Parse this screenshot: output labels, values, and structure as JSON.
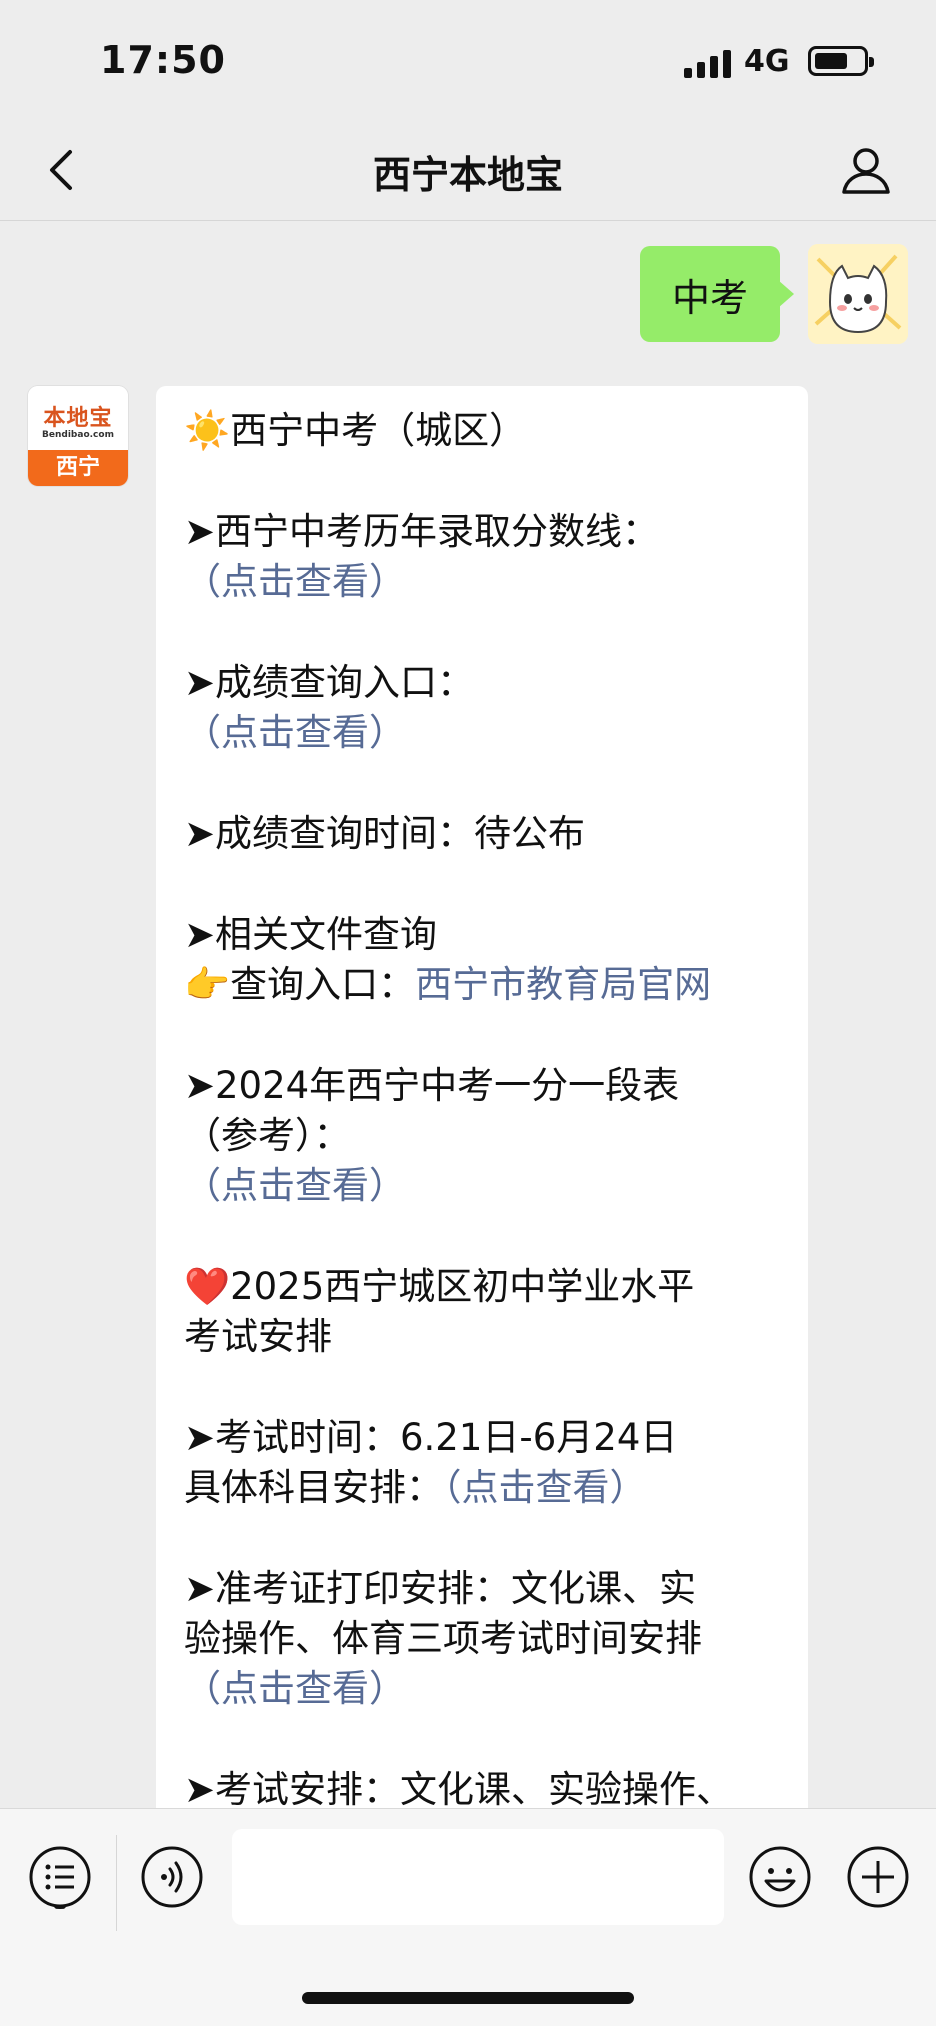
{
  "status_bar": {
    "time": "17:50",
    "network": "4G"
  },
  "nav": {
    "title": "西宁本地宝"
  },
  "user_message": {
    "text": "中考"
  },
  "bot": {
    "avatar": {
      "logo": "本地宝",
      "url": "Bendibao.com",
      "city": "西宁"
    },
    "lines": {
      "p1": "☀️西宁中考（城区）",
      "p2a": "➤西宁中考历年录取分数线：",
      "p2b": "（点击查看）",
      "p3a": "➤成绩查询入口：",
      "p3b": "（点击查看）",
      "p4": "➤成绩查询时间：待公布",
      "p5a": "➤相关文件查询",
      "p5b_prefix": "👉查询入口：",
      "p5b_link": "西宁市教育局官网",
      "p6a": "➤2024年西宁中考一分一段表",
      "p6b": "（参考）：",
      "p6c": "（点击查看）",
      "p7a": "❤️2025西宁城区初中学业水平",
      "p7b": "考试安排",
      "p8a": "➤考试时间：6.21日-6月24日",
      "p8b_prefix": "具体科目安排：",
      "p8b_link": "（点击查看）",
      "p9a": "➤准考证打印安排：文化课、实",
      "p9b": "验操作、体育三项考试时间安排",
      "p9c": "（点击查看）",
      "p10": "➤考试安排：文化课、实验操作、"
    }
  },
  "colors": {
    "user_bubble": "#95ec69",
    "link": "#576b95",
    "background": "#ededed"
  },
  "icons": [
    "signal-icon",
    "battery-icon",
    "back-arrow-icon",
    "profile-icon",
    "menu-list-icon",
    "voice-icon",
    "emoji-icon",
    "plus-icon"
  ]
}
